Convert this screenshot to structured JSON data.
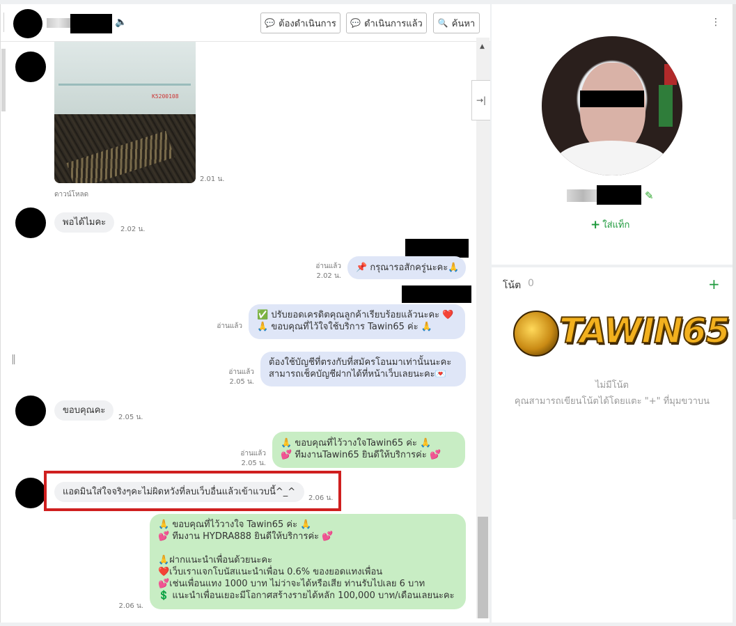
{
  "header": {
    "buttons": [
      {
        "icon": "speech-bubble-icon",
        "label": "ต้องดำเนินการ"
      },
      {
        "icon": "speech-bubble-icon",
        "label": "ดำเนินการแล้ว"
      },
      {
        "icon": "search-icon",
        "label": "ค้นหา"
      }
    ]
  },
  "messages": {
    "photo_time": "2.01 น.",
    "photo_download": "ดาวน์โหลด",
    "photo_number": "K5200108",
    "m1_text": "พอได้ไมคะ",
    "m1_time": "2.02 น.",
    "m2_read": "อ่านแล้ว",
    "m2_time": "2.02 น.",
    "m2_text": "📌 กรุณารอสักครู่นะคะ🙏",
    "m3_read": "อ่านแล้ว",
    "m3_line1": "✅ ปรับยอดเครดิตคุณลูกค้าเรียบร้อยแล้วนะคะ ❤️",
    "m3_line2": "🙏 ขอบคุณที่ไว้ใจใช้บริการ Tawin65 ค่ะ 🙏",
    "m4_read": "อ่านแล้ว",
    "m4_time": "2.05 น.",
    "m4_line1": "ต้องใช้บัญชีที่ตรงกับที่สมัครโอนมาเท่านั้นนะคะ",
    "m4_line2": "สามารถเช็คบัญชีฝากได้ที่หน้าเว็บเลยนะคะ💌",
    "m5_text": "ขอบคุณคะ",
    "m5_time": "2.05 น.",
    "m6_read": "อ่านแล้ว",
    "m6_time": "2.05 น.",
    "m6_line1": "🙏 ขอบคุณที่ไว้วางใจTawin65 ค่ะ 🙏",
    "m6_line2": "💕 ทีมงานTawin65 ยินดีให้บริการค่ะ 💕",
    "m7_text": "แอดมินใส่ใจจริงๆคะไม่ผิดหวังที่ลบเว็บอื่นแล้วเข้าแวบนี้^_^",
    "m7_time": "2.06 น.",
    "m8_line1": "🙏 ขอบคุณที่ไว้วางใจ Tawin65 ค่ะ 🙏",
    "m8_line2": "💕 ทีมงาน HYDRA888 ยินดีให้บริการค่ะ 💕",
    "m8_line3": "🙏ฝากแนะนำเพื่อนด้วยนะคะ",
    "m8_line4": "❤️เว็บเราแจกโบนัสแนะนำเพื่อน 0.6% ของยอดแทงเพื่อน",
    "m8_line5": "💕เช่นเพื่อนแทง 1000 บาท ไม่ว่าจะได้หรือเสีย ท่านรับไปเลย 6 บาท",
    "m8_line6": "💲 แนะนำเพื่อนเยอะมีโอกาศสร้างรายได้หลัก 100,000 บาท/เดือนเลยนะคะ",
    "m8_time": "2.06 น."
  },
  "profile": {
    "add_tag": "ใส่แท็ก"
  },
  "notes": {
    "title": "โน้ต",
    "count": "0",
    "logo_text": "TAWIN65",
    "empty_title": "ไม่มีโน้ต",
    "empty_hint": "คุณสามารถเขียนโน้ตได้โดยแตะ \"+\" ที่มุมขวาบน"
  },
  "colors": {
    "accent_green": "#1f9a3d",
    "highlight_red": "#cf1f1f",
    "bubble_blue": "#dfe6f7",
    "bubble_green": "#c8edc4"
  }
}
